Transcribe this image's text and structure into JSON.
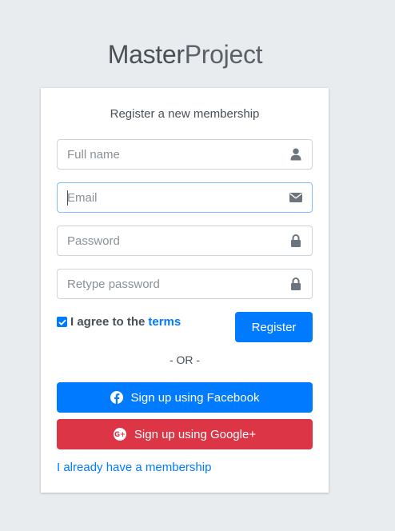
{
  "logo": {
    "bold": "Master",
    "light": "Project"
  },
  "card": {
    "message": "Register a new membership",
    "fields": {
      "fullname": {
        "placeholder": "Full name",
        "icon": "user-icon"
      },
      "email": {
        "placeholder": "Email",
        "icon": "envelope-icon"
      },
      "password": {
        "placeholder": "Password",
        "icon": "lock-icon"
      },
      "retype": {
        "placeholder": "Retype password",
        "icon": "lock-icon"
      }
    },
    "agree": {
      "text": "I agree to the",
      "link": "terms",
      "checked": true
    },
    "register_label": "Register",
    "separator": "- OR -",
    "facebook_label": "Sign up using Facebook",
    "google_label": "Sign up using Google+",
    "login_link": "I already have a membership"
  },
  "colors": {
    "primary": "#007bff",
    "danger": "#dc3545",
    "background": "#e9ecef"
  }
}
